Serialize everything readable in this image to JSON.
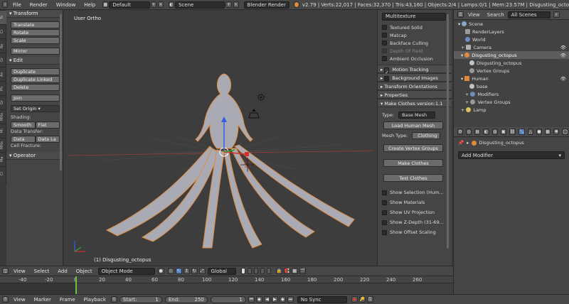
{
  "topbar": {
    "menus": [
      "File",
      "Render",
      "Window",
      "Help"
    ],
    "layout": "Default",
    "scene": "Scene",
    "engine": "Blender Render",
    "stats": "v2.79 | Verts:22,017 | Faces:32,370 | Tris:43,160 | Objects:2/4 | Lamps:0/1 | Mem:23.57M | Disgusting_octo"
  },
  "left_tabs": [
    "To",
    "Cr",
    "Re",
    "Gr",
    "An",
    "Ph",
    "Gr",
    "MHx",
    "Mi",
    "MHx",
    "Ma",
    "Cl"
  ],
  "toolshelf": {
    "transform_title": "Transform",
    "translate": "Translate",
    "rotate": "Rotate",
    "scale": "Scale",
    "mirror": "Mirror",
    "edit_title": "Edit",
    "duplicate": "Duplicate",
    "duplicate_linked": "Duplicate Linked",
    "delete": "Delete",
    "join": "Join",
    "set_origin": "Set Origin",
    "shading_label": "Shading:",
    "smooth": "Smooth",
    "flat": "Flat",
    "data_transfer_label": "Data Transfer:",
    "data": "Data",
    "data_la": "Data La",
    "cell_fracture_label": "Cell Fracture:",
    "operator_title": "Operator"
  },
  "viewport": {
    "view_label": "User Ortho",
    "object_label": "(1) Disgusting_octopus"
  },
  "properties_panel": {
    "dropdown": "Multitexture",
    "checks": [
      {
        "label": "Textured Solid",
        "on": false
      },
      {
        "label": "Matcap",
        "on": false
      },
      {
        "label": "Backface Culling",
        "on": false
      },
      {
        "label": "Depth Of Field",
        "on": false
      },
      {
        "label": "Ambient Occlusion",
        "on": false
      }
    ],
    "motion_tracking": "Motion Tracking",
    "background_images": "Background Images",
    "transform_orientations": "Transform Orientations",
    "properties": "Properties",
    "make_clothes": "Make Clothes version:1.1",
    "type_label": "Type:",
    "type_value": "Base Mesh",
    "load_human": "Load Human Mesh",
    "mesh_type_label": "Mesh Type:",
    "mesh_type_value": "Clothing",
    "create_vertex_groups": "Create Vertex Groups",
    "make_clothes_btn": "Make Clothes",
    "test_clothes": "Test Clothes",
    "show_options": [
      "Show Selection (Hum...",
      "Show Materials",
      "Show UV Projection",
      "Show Z-Depth (31-69...",
      "Show Offset Scaling"
    ]
  },
  "outliner": {
    "view": "View",
    "search": "Search",
    "filter": "All Scenes",
    "rows": [
      {
        "label": "Scene",
        "color": "#8aa8c8"
      },
      {
        "label": "RenderLayers",
        "color": "#9a9a9a"
      },
      {
        "label": "World",
        "color": "#6c8fbf"
      },
      {
        "label": "Camera",
        "color": "#b0b0b0"
      },
      {
        "label": "Disgusting_octopus",
        "color": "#e08a3c"
      },
      {
        "label": "Disgusting_octopus",
        "color": "#c3c3c3"
      },
      {
        "label": "Vertex Groups",
        "color": "#9a9a9a"
      },
      {
        "label": "Human",
        "color": "#e08a3c"
      },
      {
        "label": "base",
        "color": "#c3c3c3"
      },
      {
        "label": "Modifiers",
        "color": "#6c8fbf"
      },
      {
        "label": "Vertex Groups",
        "color": "#9a9a9a"
      },
      {
        "label": "Lamp",
        "color": "#e0c060"
      }
    ]
  },
  "modifier_panel": {
    "object_name": "Disgusting_octopus",
    "add_modifier": "Add Modifier"
  },
  "viewport_header": {
    "menus": [
      "View",
      "Select",
      "Add",
      "Object"
    ],
    "mode": "Object Mode",
    "orientation": "Global"
  },
  "timeline": {
    "ticks": [
      "-40",
      "-20",
      "0",
      "20",
      "40",
      "60",
      "80",
      "100",
      "120",
      "140",
      "160",
      "180",
      "200",
      "220",
      "240",
      "260"
    ],
    "menus": [
      "View",
      "Marker",
      "Frame",
      "Playback"
    ],
    "start_label": "Start:",
    "start": "1",
    "end_label": "End:",
    "end": "250",
    "current": "1",
    "sync": "No Sync"
  }
}
